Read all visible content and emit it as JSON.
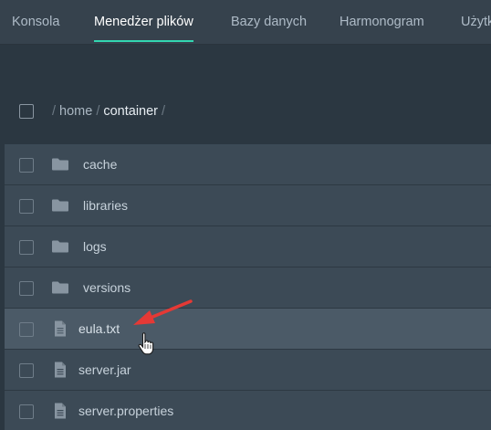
{
  "tabs": [
    {
      "label": "Konsola",
      "active": false
    },
    {
      "label": "Menedżer plików",
      "active": true
    },
    {
      "label": "Bazy danych",
      "active": false
    },
    {
      "label": "Harmonogram",
      "active": false
    },
    {
      "label": "Użytk",
      "active": false
    }
  ],
  "breadcrumb": {
    "sep": "/",
    "segments": [
      "home",
      "container"
    ]
  },
  "files": [
    {
      "name": "cache",
      "type": "folder"
    },
    {
      "name": "libraries",
      "type": "folder"
    },
    {
      "name": "logs",
      "type": "folder"
    },
    {
      "name": "versions",
      "type": "folder"
    },
    {
      "name": "eula.txt",
      "type": "file",
      "highlighted": true
    },
    {
      "name": "server.jar",
      "type": "file"
    },
    {
      "name": "server.properties",
      "type": "file"
    }
  ],
  "colors": {
    "accent": "#33d6b1",
    "annotation_arrow": "#e53935",
    "background": "#2b3741",
    "row": "#3c4a56",
    "row_hover": "#4b5a67"
  },
  "icons": {
    "folder": "folder-icon",
    "file": "file-text-icon",
    "cursor": "hand-pointer-cursor",
    "annotation": "red-arrow-annotation"
  }
}
